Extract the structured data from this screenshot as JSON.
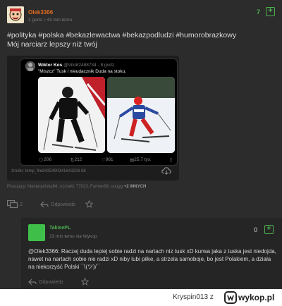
{
  "post": {
    "author": "Olek3366",
    "meta": "1 godz. i 44 min temu",
    "votes": "7",
    "plus_symbol": "+",
    "tags": "#polityka #polska #bekazlewactwa #bekazpodludzi #humorobrazkowy",
    "subtitle": "Mój narciarz lepszy niż twój",
    "embed": {
      "tweet": {
        "name": "Wiktor Kos",
        "handle": "@Vito82488734 · 8 godz.",
        "text": "\"Miszcz\" Tusk i nieudacznik Duda na stoku.",
        "stats": {
          "replies": "206",
          "retweets": "212",
          "likes": "961",
          "views": "25,7 tys."
        }
      },
      "source": "źródło: temp_file8425490341643226 88"
    },
    "pluses": "Plusujący: Masterpolska94, n1craM, 77023, Farmer96, uuugg",
    "pluses_more": "+2 INNYCH",
    "comment_count": "2",
    "reply_label": "Odpowiedz"
  },
  "reply": {
    "author": "TakisePL",
    "meta": "23 min temu   via Wykop",
    "votes": "0",
    "plus_symbol": "+",
    "mention": "@Olek3366",
    "text": ": Raczej duda lepiej sobie radzi na nartach niz tusk xD kurwa jaka z tuska jest niedojda, nawet na nartach sobie nie radzi xD niby lubi piłke, a strzela samoboje, bo jest Polakiem, a działa na niekorzyść Polski ¯\\(ツ)/¯",
    "reply_label": "Odpowiedz"
  },
  "footer": {
    "user": "Kryspin013  z",
    "logo": "wykop.pl"
  },
  "colors": {
    "accent_green": "#4caf50",
    "author_orange": "#e06a1e"
  }
}
